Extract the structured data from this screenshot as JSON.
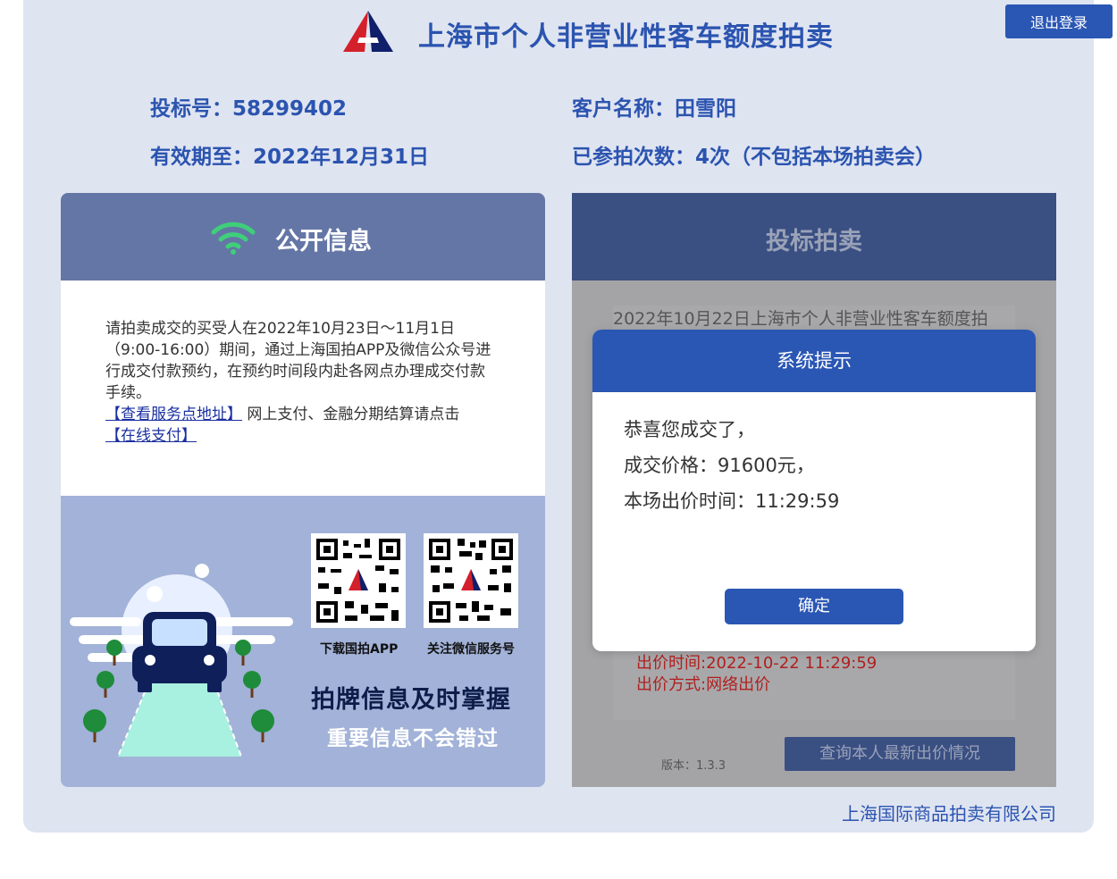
{
  "header": {
    "title": "上海市个人非营业性客车额度拍卖",
    "logout_label": "退出登录"
  },
  "user_info": {
    "bid_number": "投标号：58299402",
    "customer_name": "客户名称：田雪阳",
    "valid_until": "有效期至：2022年12月31日",
    "participation_count": "已参拍次数：4次（不包括本场拍卖会）"
  },
  "public_info": {
    "heading": "公开信息",
    "notice_text": "请拍卖成交的买受人在2022年10月23日～11月1日（9:00-16:00）期间，通过上海国拍APP及微信公众号进行成交付款预约，在预约时间段内赴各网点办理成交付款手续。",
    "service_link": "【查看服务点地址】",
    "pay_text": " 网上支付、金融分期结算请点击",
    "pay_link": "【在线支付】",
    "qr_app_caption": "下载国拍APP",
    "qr_wechat_caption": "关注微信服务号",
    "slogan_main": "拍牌信息及时掌握",
    "slogan_sub": "重要信息不会错过"
  },
  "bidding": {
    "heading": "投标拍卖",
    "session_text": "2022年10月22日上海市个人非营业性客车额度拍",
    "bid_time": "出价时间:2022-10-22 11:29:59",
    "bid_method": "出价方式:网络出价",
    "version": "版本：1.3.3",
    "query_button": "查询本人最新出价情况"
  },
  "dialog": {
    "title": "系统提示",
    "line1": "恭喜您成交了，",
    "line2": "成交价格：91600元，",
    "line3": "本场出价时间：11:29:59",
    "ok_label": "确定"
  },
  "footer": {
    "company": "上海国际商品拍卖有限公司"
  },
  "colors": {
    "brand_blue": "#2a56b4",
    "panel_bg": "#dfe4f1",
    "left_header": "#6476a6",
    "right_header": "#3a4f82",
    "bid_red": "#b02020"
  }
}
